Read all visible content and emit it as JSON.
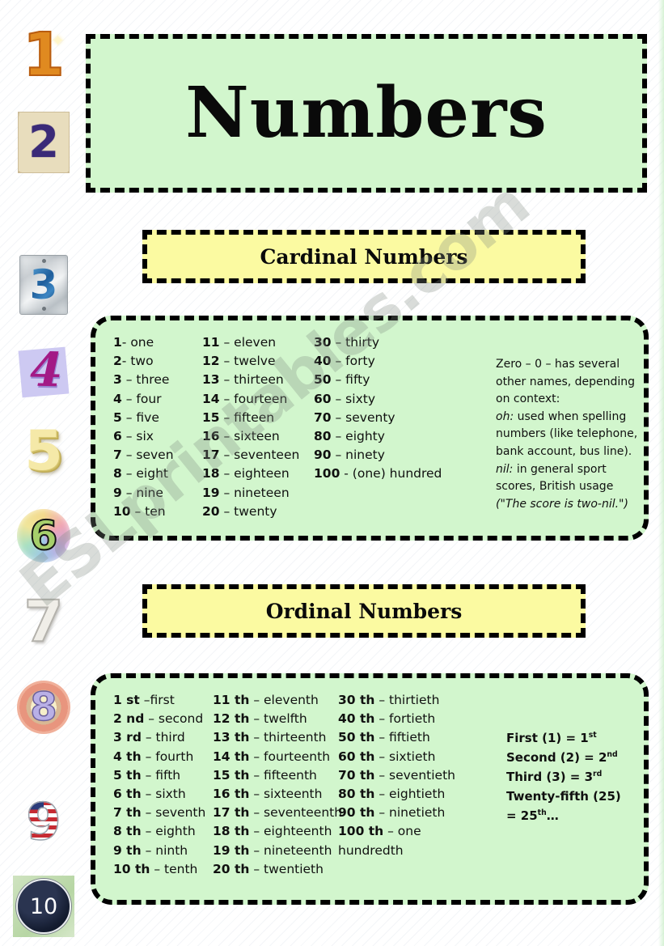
{
  "page": {
    "title": "Numbers",
    "watermark": "ESLprintables.com",
    "colors": {
      "green_panel": "#D2F6CD",
      "yellow_header": "#FBFAA1",
      "border": "#000000",
      "text": "#101010"
    }
  },
  "number_images": [
    {
      "value": "1",
      "style": "golden gradient numeral with sparkle"
    },
    {
      "value": "2",
      "style": "blue mosaic numeral on cracked cream tile"
    },
    {
      "value": "3",
      "style": "blue numeral on metal house plate"
    },
    {
      "value": "4",
      "style": "magenta brush numeral on lavender square"
    },
    {
      "value": "5",
      "style": "cream 3D extruded numeral"
    },
    {
      "value": "6",
      "style": "green numeral on pastel rainbow circle"
    },
    {
      "value": "7",
      "style": "pale grey outlined numeral"
    },
    {
      "value": "8",
      "style": "lavender numeral on pink dotted circle"
    },
    {
      "value": "9",
      "style": "american flag patterned numeral"
    },
    {
      "value": "10",
      "style": "white numeral in navy circle on green square"
    }
  ],
  "cardinal": {
    "heading": "Cardinal Numbers",
    "column1": [
      {
        "num": "1",
        "sep": "- ",
        "word": "one"
      },
      {
        "num": "2",
        "sep": "- ",
        "word": "two"
      },
      {
        "num": "3",
        "sep": " – ",
        "word": "three"
      },
      {
        "num": "4",
        "sep": " – ",
        "word": "four"
      },
      {
        "num": "5",
        "sep": " – ",
        "word": "five"
      },
      {
        "num": "6",
        "sep": " – ",
        "word": "six"
      },
      {
        "num": "7",
        "sep": " – ",
        "word": "seven"
      },
      {
        "num": "8",
        "sep": " – ",
        "word": "eight"
      },
      {
        "num": "9",
        "sep": " – ",
        "word": "nine"
      },
      {
        "num": "10",
        "sep": " – ",
        "word": "ten"
      }
    ],
    "column2": [
      {
        "num": "11",
        "sep": " – ",
        "word": "eleven"
      },
      {
        "num": "12",
        "sep": " – ",
        "word": "twelve"
      },
      {
        "num": "13",
        "sep": " – ",
        "word": "thirteen"
      },
      {
        "num": "14",
        "sep": " – ",
        "word": "fourteen"
      },
      {
        "num": "15",
        "sep": " – ",
        "word": "fifteen"
      },
      {
        "num": "16",
        "sep": " – ",
        "word": "sixteen"
      },
      {
        "num": "17",
        "sep": " – ",
        "word": "seventeen"
      },
      {
        "num": "18",
        "sep": " – ",
        "word": "eighteen"
      },
      {
        "num": "19",
        "sep": " – ",
        "word": "nineteen"
      },
      {
        "num": "20",
        "sep": " – ",
        "word": "twenty"
      }
    ],
    "column3": [
      {
        "num": "30",
        "sep": " –  ",
        "word": "thirty"
      },
      {
        "num": "40",
        "sep": " – ",
        "word": "forty"
      },
      {
        "num": "50",
        "sep": " – ",
        "word": "fifty"
      },
      {
        "num": "60",
        "sep": " – ",
        "word": "sixty"
      },
      {
        "num": "70",
        "sep": " – ",
        "word": "seventy"
      },
      {
        "num": "80",
        "sep": " – ",
        "word": "eighty"
      },
      {
        "num": "90",
        "sep": " – ",
        "word": "ninety"
      },
      {
        "num": "100",
        "sep": " - ",
        "word": "(one) hundred"
      }
    ],
    "zero_note": [
      {
        "lead": "",
        "lead_italic": false,
        "text": "Zero – 0 – has several"
      },
      {
        "lead": "",
        "lead_italic": false,
        "text": "other names, depending"
      },
      {
        "lead": "",
        "lead_italic": false,
        "text": "on context:"
      },
      {
        "lead": "oh:",
        "lead_italic": true,
        "text": " used when spelling"
      },
      {
        "lead": "",
        "lead_italic": false,
        "text": "numbers (like telephone,"
      },
      {
        "lead": "",
        "lead_italic": false,
        "text": "bank account, bus line)."
      },
      {
        "lead": "nil:",
        "lead_italic": true,
        "text": " in general sport"
      },
      {
        "lead": "",
        "lead_italic": false,
        "text": "scores, British usage"
      },
      {
        "lead": "",
        "lead_italic": true,
        "text": "(\"The score is two-nil.\")"
      }
    ]
  },
  "ordinal": {
    "heading": "Ordinal Numbers",
    "column1": [
      {
        "num": "1",
        "suffix": "st",
        "sep": " –",
        "word": "first"
      },
      {
        "num": "2",
        "suffix": "nd",
        "sep": " – ",
        "word": "second"
      },
      {
        "num": "3",
        "suffix": "rd",
        "sep": " – ",
        "word": "third"
      },
      {
        "num": "4",
        "suffix": "th",
        "sep": " – ",
        "word": "fourth"
      },
      {
        "num": "5",
        "suffix": "th",
        "sep": " – ",
        "word": "fifth"
      },
      {
        "num": "6",
        "suffix": "th",
        "sep": " – ",
        "word": "sixth"
      },
      {
        "num": "7",
        "suffix": "th",
        "sep": " – ",
        "word": "seventh"
      },
      {
        "num": "8",
        "suffix": "th",
        "sep": " – ",
        "word": "eighth"
      },
      {
        "num": "9",
        "suffix": "th",
        "sep": " – ",
        "word": "ninth"
      },
      {
        "num": "10",
        "suffix": "th",
        "sep": " – ",
        "word": "tenth"
      }
    ],
    "column2": [
      {
        "num": "11",
        "suffix": "th",
        "sep": " – ",
        "word": "eleventh"
      },
      {
        "num": "12",
        "suffix": "th",
        "sep": " – ",
        "word": "twelfth"
      },
      {
        "num": "13",
        "suffix": "th",
        "sep": " – ",
        "word": "thirteenth"
      },
      {
        "num": "14",
        "suffix": "th",
        "sep": " – ",
        "word": "fourteenth"
      },
      {
        "num": "15",
        "suffix": "th",
        "sep": " – ",
        "word": "fifteenth"
      },
      {
        "num": "16",
        "suffix": "th",
        "sep": " – ",
        "word": "sixteenth"
      },
      {
        "num": "17",
        "suffix": "th",
        "sep": " – ",
        "word": "seventeenth"
      },
      {
        "num": "18",
        "suffix": "th",
        "sep": " – ",
        "word": "eighteenth"
      },
      {
        "num": "19",
        "suffix": "th",
        "sep": " – ",
        "word": "nineteenth"
      },
      {
        "num": "20",
        "suffix": "th",
        "sep": " – ",
        "word": "twentieth"
      }
    ],
    "column3": [
      {
        "num": "30",
        "suffix": "th",
        "sep": " – ",
        "word": "thirtieth"
      },
      {
        "num": "40",
        "suffix": "th",
        "sep": " – ",
        "word": "fortieth"
      },
      {
        "num": "50",
        "suffix": "th",
        "sep": " – ",
        "word": "fiftieth"
      },
      {
        "num": "60",
        "suffix": "th",
        "sep": " – ",
        "word": "sixtieth"
      },
      {
        "num": "70",
        "suffix": "th",
        "sep": " – ",
        "word": "seventieth"
      },
      {
        "num": "80",
        "suffix": "th",
        "sep": " – ",
        "word": "eightieth"
      },
      {
        "num": "90",
        "suffix": "th",
        "sep": " – ",
        "word": "ninetieth"
      },
      {
        "num": "100",
        "suffix": "th",
        "sep": " – ",
        "word": "one"
      },
      {
        "num": "",
        "suffix": "",
        "sep": "",
        "word": "hundredth"
      }
    ],
    "examples": [
      {
        "text": "First (1) = 1",
        "sup": "st"
      },
      {
        "text": "Second (2) = 2",
        "sup": "nd"
      },
      {
        "text": "Third (3) = 3",
        "sup": "rd"
      },
      {
        "text": "Twenty-fifth (25)",
        "sup": ""
      },
      {
        "text": "= 25",
        "sup": "th",
        "tail": "…"
      }
    ]
  }
}
